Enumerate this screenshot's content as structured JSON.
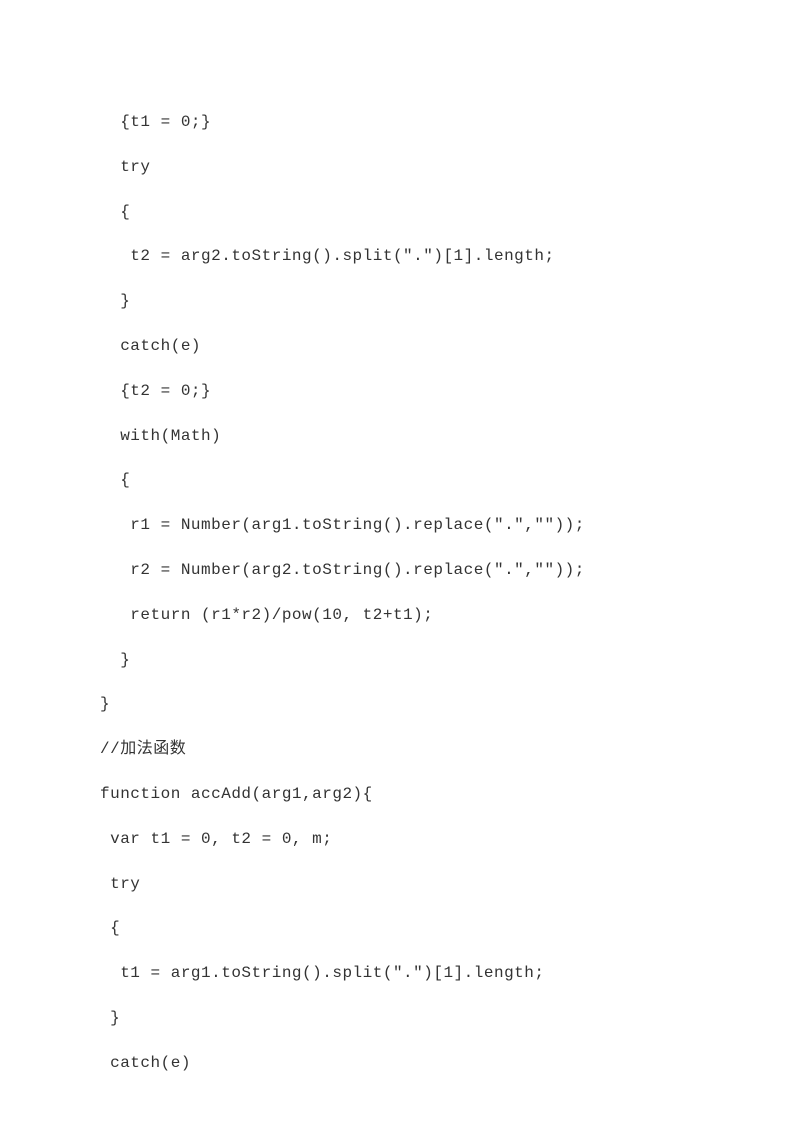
{
  "code_lines": [
    "  {t1 = 0;}",
    "  try",
    "  {",
    "   t2 = arg2.toString().split(\".\")[1].length;",
    "  }",
    "  catch(e)",
    "  {t2 = 0;}",
    "  with(Math)",
    "  {",
    "   r1 = Number(arg1.toString().replace(\".\",\"\"));",
    "   r2 = Number(arg2.toString().replace(\".\",\"\"));",
    "   return (r1*r2)/pow(10, t2+t1);",
    "  }",
    "}",
    "//加法函数",
    "function accAdd(arg1,arg2){",
    " var t1 = 0, t2 = 0, m;",
    " try",
    " {",
    "  t1 = arg1.toString().split(\".\")[1].length;",
    " }",
    " catch(e)"
  ]
}
